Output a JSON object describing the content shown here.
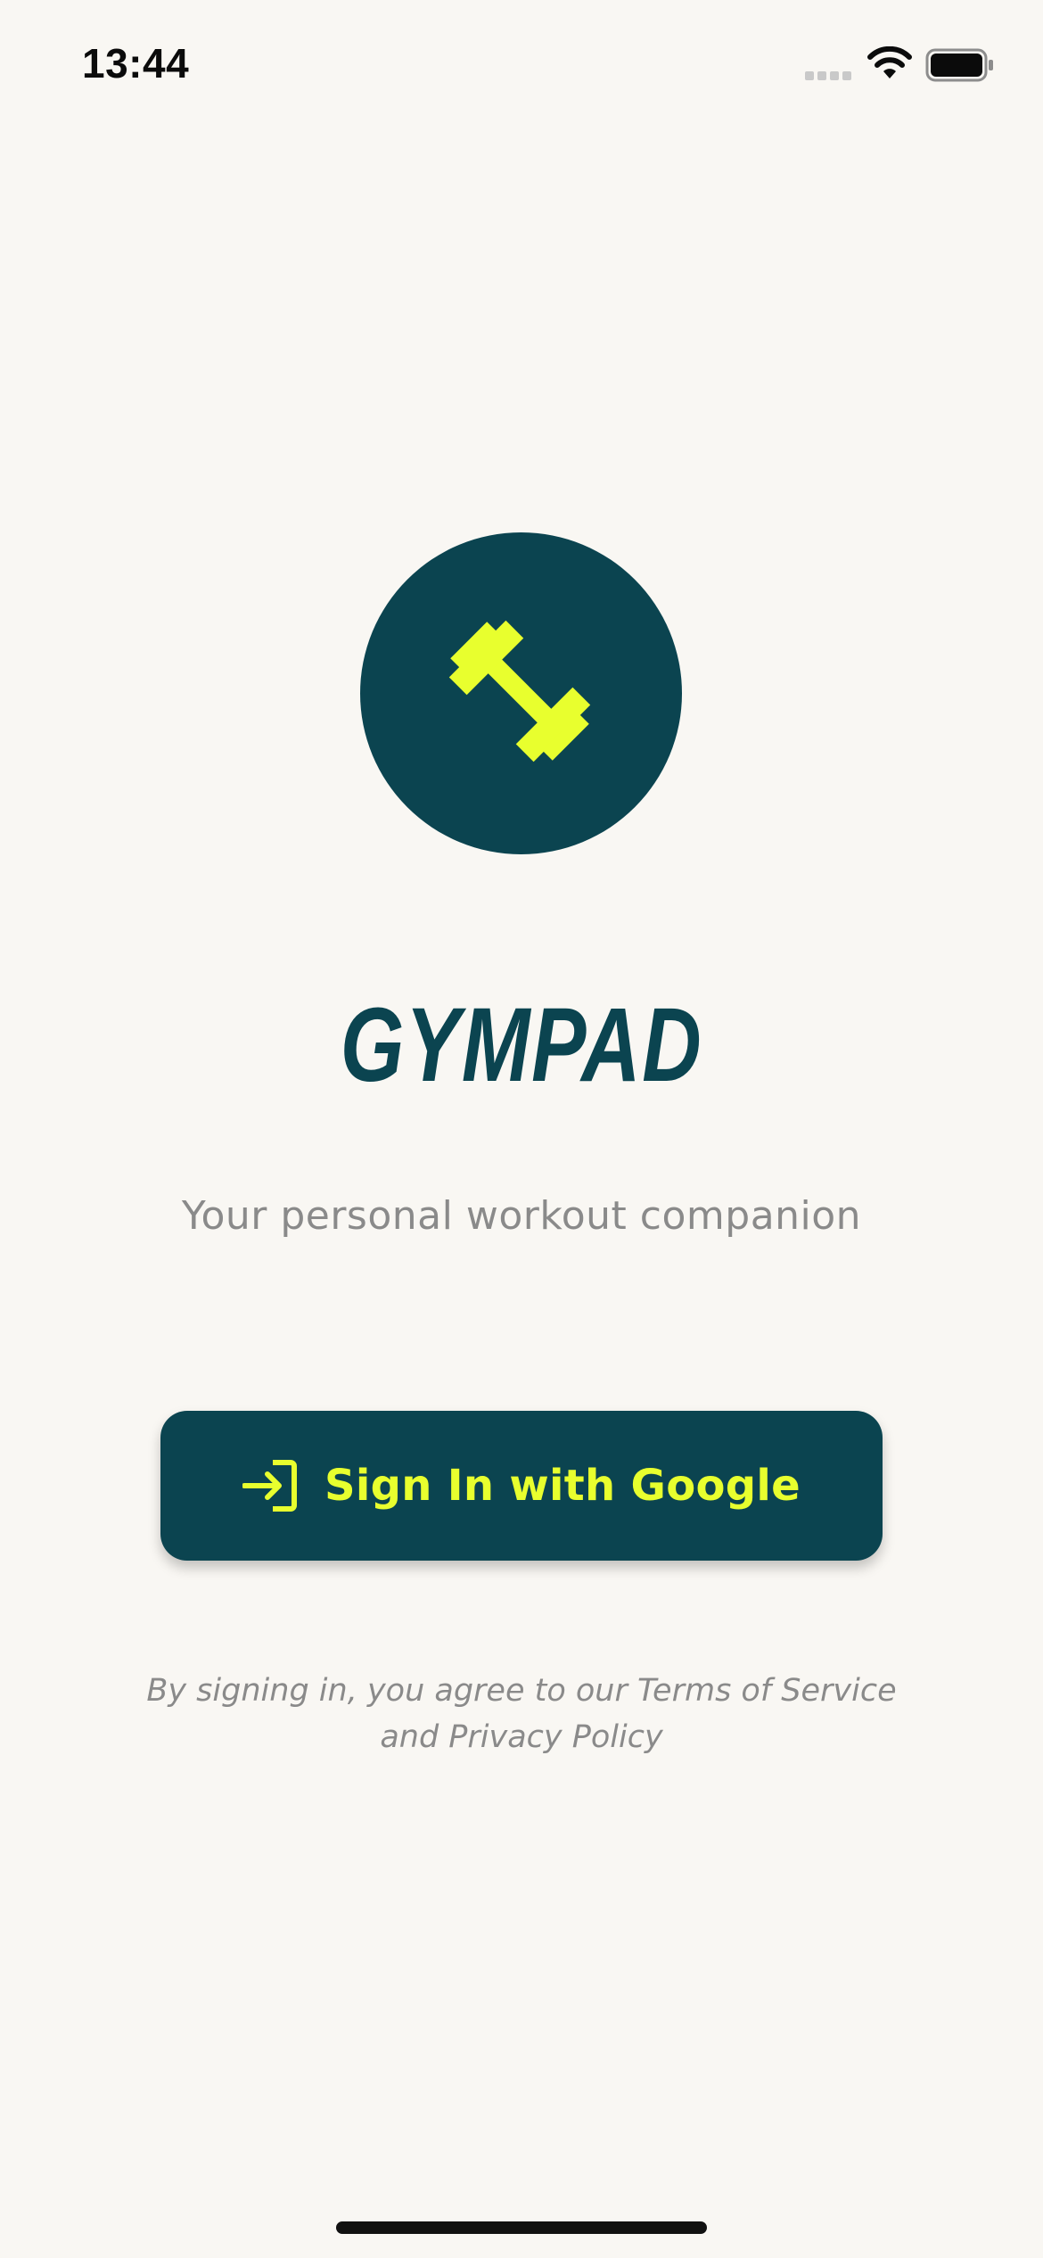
{
  "status_bar": {
    "time": "13:44"
  },
  "app": {
    "title": "GYMPAD",
    "tagline": "Your personal workout companion"
  },
  "signin": {
    "label": "Sign In with Google"
  },
  "legal": {
    "line1": "By signing in, you agree to our Terms of Service",
    "line2": "and Privacy Policy"
  },
  "icons": {
    "logo": "dumbbell-icon",
    "signin": "login-arrow-icon"
  },
  "colors": {
    "background": "#f9f7f3",
    "brand": "#0b4450",
    "accent": "#e8ff2e",
    "muted_text": "#8a8a8a"
  }
}
